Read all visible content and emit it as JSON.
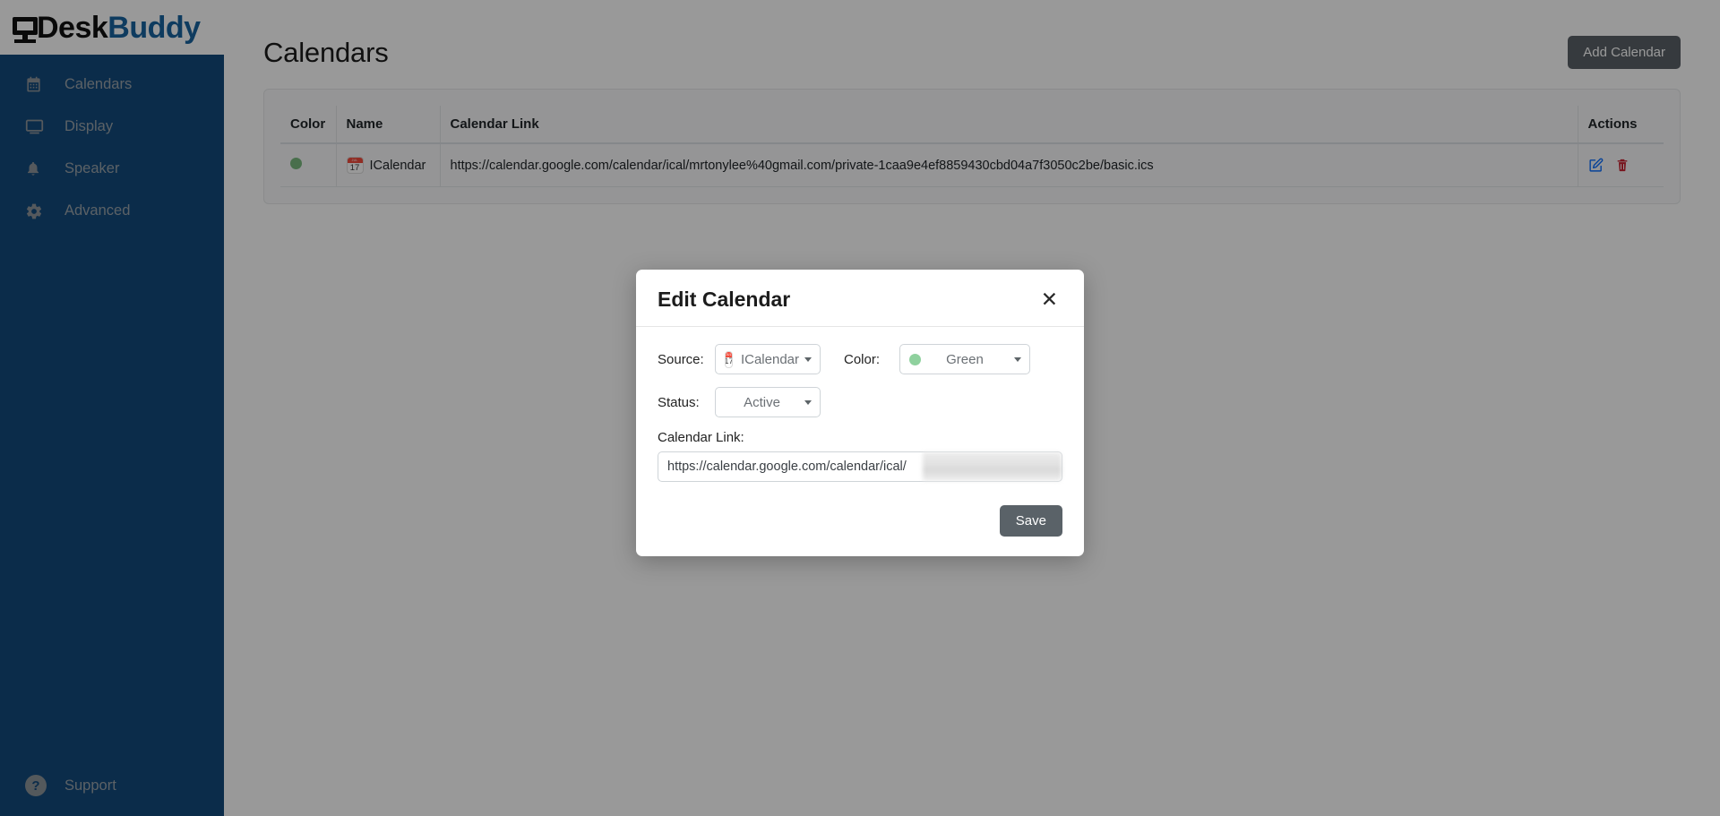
{
  "brand": {
    "logo_desk": "Desk",
    "logo_buddy": "Buddy",
    "monitor_icon": "monitor-icon",
    "colors": {
      "sidebar": "#134A7C",
      "brand_blue": "#18639E",
      "accent_green": "#7ab97f",
      "button_gray": "#5a6268",
      "delete_red": "#c82333",
      "edit_blue": "#0d6efd"
    }
  },
  "sidebar": {
    "items": [
      {
        "label": "Calendars",
        "icon": "calendar-icon"
      },
      {
        "label": "Display",
        "icon": "monitor-icon"
      },
      {
        "label": "Speaker",
        "icon": "bell-icon"
      },
      {
        "label": "Advanced",
        "icon": "gear-icon"
      }
    ],
    "support": {
      "label": "Support",
      "icon": "question-circle-icon"
    }
  },
  "main": {
    "title": "Calendars",
    "add_button": "Add Calendar",
    "table": {
      "headers": [
        "Color",
        "Name",
        "Calendar Link",
        "Actions"
      ],
      "rows": [
        {
          "color": "Green",
          "color_hex": "#7ab97f",
          "name": "ICalendar",
          "name_icon": "ical-calendar-icon",
          "name_icon_day": "17",
          "name_icon_month": "JUL",
          "link": "https://calendar.google.com/calendar/ical/mrtonylee%40gmail.com/private-1caa9e4ef8859430cbd04a7f3050c2be/basic.ics",
          "edit_icon": "edit-pencil-icon",
          "delete_icon": "trash-icon"
        }
      ]
    }
  },
  "modal": {
    "title": "Edit Calendar",
    "close_icon": "close-icon",
    "source": {
      "label": "Source:",
      "value": "ICalendar",
      "icon": "ical-calendar-icon",
      "icon_day": "17",
      "icon_month": "JUL"
    },
    "color": {
      "label": "Color:",
      "value": "Green",
      "swatch_hex": "#8fd19e"
    },
    "status": {
      "label": "Status:",
      "value": "Active"
    },
    "link": {
      "label": "Calendar Link:",
      "value": "https://calendar.google.com/calendar/ical/"
    },
    "save_button": "Save"
  }
}
